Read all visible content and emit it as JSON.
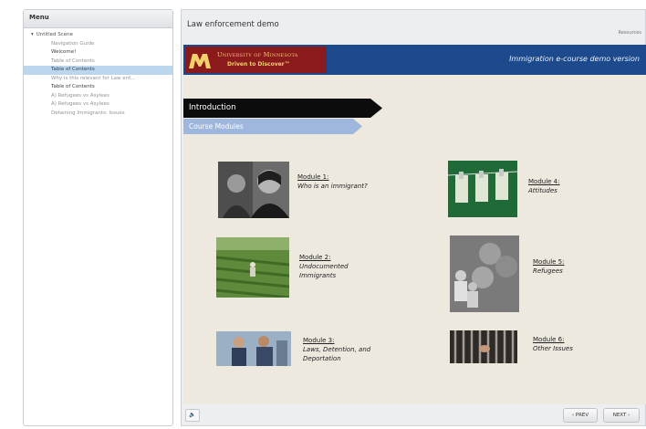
{
  "menu": {
    "title": "Menu",
    "items": [
      {
        "label": "Untitled Scene"
      },
      {
        "label": "Navigation Guide"
      },
      {
        "label": "Welcome!"
      },
      {
        "label": "Table of Contents"
      },
      {
        "label": "Table of Contents"
      },
      {
        "label": "Why is this relevant for Law enf..."
      },
      {
        "label": "Table of Contents"
      },
      {
        "label": "A) Refugees vs Asylees"
      },
      {
        "label": "A) Refugees vs Asylees"
      },
      {
        "label": "Detaining Immigrants: Issues"
      }
    ]
  },
  "player": {
    "title": "Law enforcement demo",
    "resources": "Resources"
  },
  "banner": {
    "university": "University of Minnesota",
    "tagline": "Driven to Discover™",
    "course_title": "Immigration e-course demo version"
  },
  "tabs": {
    "introduction": "Introduction",
    "course_modules": "Course Modules"
  },
  "modules": [
    {
      "number": "Module 1:",
      "title": "Who is an immigrant?"
    },
    {
      "number": "Module 2:",
      "title": "Undocumented Immigrants"
    },
    {
      "number": "Module 3:",
      "title": "Laws, Detention, and Deportation"
    },
    {
      "number": "Module 4:",
      "title": "Attitudes"
    },
    {
      "number": "Module 5:",
      "title": "Refugees"
    },
    {
      "number": "Module 6:",
      "title": "Other Issues"
    }
  ],
  "controls": {
    "audio": "🔈",
    "prev": "‹ PREV",
    "next": "NEXT ›"
  },
  "colors": {
    "banner_blue": "#1d4a8c",
    "umn_maroon": "#8b1a1d",
    "umn_gold": "#f3d16a",
    "menu_selected": "#bcd6ee",
    "slide_bg": "#ede9df"
  }
}
